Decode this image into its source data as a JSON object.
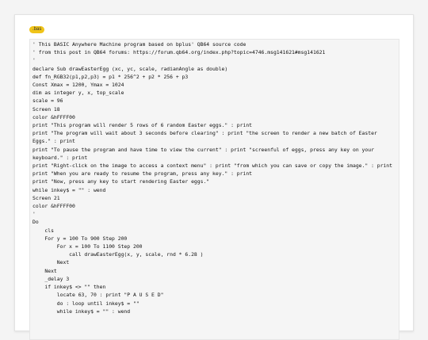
{
  "file_badge": {
    "label": ".bas",
    "color": "#f0c419"
  },
  "code": {
    "lines": [
      "' This BASIC Anywhere Machine program based on bplus' QB64 source code",
      "' from this post in QB64 forums: https://forum.qb64.org/index.php?topic=4746.msg141621#msg141621",
      "'",
      "declare Sub drawEasterEgg (xc, yc, scale, radianAngle as double)",
      "def fn_RGB32(p1,p2,p3) = p1 * 256^2 + p2 * 256 + p3",
      "Const Xmax = 1200, Ymax = 1024",
      "dim as integer y, x, top_scale",
      "scale = 96",
      "Screen 18",
      "color &hFFFF00",
      "print \"This program will render 5 rows of 6 random Easter eggs.\" : print",
      "print \"The program will wait about 3 seconds before clearing\" : print \"the screen to render a new batch of Easter Eggs.\" : print",
      "print \"To pause the program and have time to view the current\" : print \"screenful of eggs, press any key on your keyboard.\" : print",
      "print \"Right-click on the image to access a context menu\" : print \"from which you can save or copy the image.\" : print",
      "print \"When you are ready to resume the program, press any key.\" : print",
      "print \"Now, press any key to start rendering Easter eggs.\"",
      "while inkey$ = \"\" : wend",
      "Screen 21",
      "color &hFFFF00",
      "'",
      "Do",
      "    cls",
      "    For y = 100 To 900 Step 200",
      "        For x = 100 To 1100 Step 200",
      "            call drawEasterEgg(x, y, scale, rnd * 6.28 )",
      "        Next",
      "    Next",
      "    _delay 3",
      "    if inkey$ <> \"\" then",
      "        locate 63, 70 : print \"P A U S E D\"",
      "        do : loop until inkey$ = \"\"",
      "        while inkey$ = \"\" : wend"
    ]
  }
}
